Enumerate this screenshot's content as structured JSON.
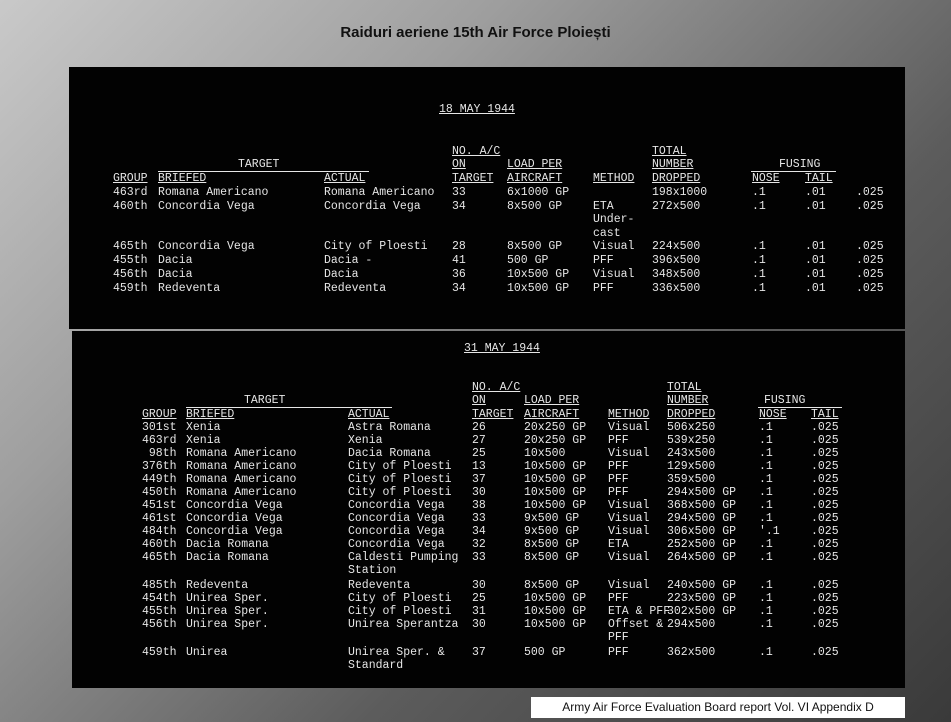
{
  "title": "Raiduri aeriene 15th Air Force Ploiești",
  "source": "Army Air Force  Evaluation Board report Vol. VI Appendix D",
  "tables": [
    {
      "date": "18 MAY 1944",
      "headers": {
        "group": "GROUP",
        "target": "TARGET",
        "briefed": "BRIEFED",
        "actual": "ACTUAL",
        "ac": [
          "NO. A/C",
          "ON",
          "TARGET"
        ],
        "load": [
          "LOAD PER",
          "AIRCRAFT"
        ],
        "method": "METHOD",
        "total": [
          "TOTAL",
          "NUMBER",
          "DROPPED"
        ],
        "fusing": "FUSING",
        "nose": "NOSE",
        "tail": "TAIL"
      },
      "rows": [
        {
          "group": "463rd",
          "briefed": "Romana Americano",
          "actual": "Romana Americano",
          "ac": "33",
          "load": "6x1000 GP",
          "method": "",
          "total": "198x1000",
          "nose": ".1",
          "tail": ".01",
          "extra": ".025"
        },
        {
          "group": "460th",
          "briefed": "Concordia Vega",
          "actual": "Concordia Vega",
          "ac": "34",
          "load": "8x500 GP",
          "method": "ETA\nUnder-\ncast",
          "total": "272x500",
          "nose": ".1",
          "tail": ".01",
          "extra": ".025"
        },
        {
          "group": "465th",
          "briefed": "Concordia Vega",
          "actual": "City of Ploesti",
          "ac": "28",
          "load": "8x500 GP",
          "method": "Visual",
          "total": "224x500",
          "nose": ".1",
          "tail": ".01",
          "extra": ".025"
        },
        {
          "group": "455th",
          "briefed": "Dacia",
          "actual": "Dacia -",
          "ac": "41",
          "load": "500 GP",
          "method": "PFF",
          "total": "396x500",
          "nose": ".1",
          "tail": ".01",
          "extra": ".025"
        },
        {
          "group": "456th",
          "briefed": "Dacia",
          "actual": "Dacia",
          "ac": "36",
          "load": "10x500 GP",
          "method": "Visual",
          "total": "348x500",
          "nose": ".1",
          "tail": ".01",
          "extra": ".025"
        },
        {
          "group": "459th",
          "briefed": "Redeventa",
          "actual": "Redeventa",
          "ac": "34",
          "load": "10x500 GP",
          "method": "PFF",
          "total": "336x500",
          "nose": ".1",
          "tail": ".01",
          "extra": ".025"
        }
      ]
    },
    {
      "date": "31 MAY 1944",
      "headers": {
        "group": "GROUP",
        "target": "TARGET",
        "briefed": "BRIEFED",
        "actual": "ACTUAL",
        "ac": [
          "NO. A/C",
          "ON",
          "TARGET"
        ],
        "load": [
          "LOAD PER",
          "AIRCRAFT"
        ],
        "method": "METHOD",
        "total": [
          "TOTAL",
          "NUMBER",
          "DROPPED"
        ],
        "fusing": "FUSING",
        "nose": "NOSE",
        "tail": "TAIL"
      },
      "rows": [
        {
          "group": "301st",
          "briefed": "Xenia",
          "actual": "Astra Romana",
          "ac": "26",
          "load": "20x250 GP",
          "method": "Visual",
          "total": "506x250",
          "nose": ".1",
          "tail": ".025"
        },
        {
          "group": "463rd",
          "briefed": "Xenia",
          "actual": "Xenia",
          "ac": "27",
          "load": "20x250 GP",
          "method": "PFF",
          "total": "539x250",
          "nose": ".1",
          "tail": ".025"
        },
        {
          "group": "98th",
          "briefed": "Romana Americano",
          "actual": "Dacia Romana",
          "ac": "25",
          "load": "10x500",
          "method": "Visual",
          "total": "243x500",
          "nose": ".1",
          "tail": ".025"
        },
        {
          "group": "376th",
          "briefed": "Romana Americano",
          "actual": "City of Ploesti",
          "ac": "13",
          "load": "10x500 GP",
          "method": "PFF",
          "total": "129x500",
          "nose": ".1",
          "tail": ".025"
        },
        {
          "group": "449th",
          "briefed": "Romana Americano",
          "actual": "City of Ploesti",
          "ac": "37",
          "load": "10x500 GP",
          "method": "PFF",
          "total": "359x500",
          "nose": ".1",
          "tail": ".025"
        },
        {
          "group": "450th",
          "briefed": "Romana Americano",
          "actual": "City of Ploesti",
          "ac": "30",
          "load": "10x500 GP",
          "method": "PFF",
          "total": "294x500 GP",
          "nose": ".1",
          "tail": ".025"
        },
        {
          "group": "451st",
          "briefed": "Concordia Vega",
          "actual": "Concordia Vega",
          "ac": "38",
          "load": "10x500 GP",
          "method": "Visual",
          "total": "368x500 GP",
          "nose": ".1",
          "tail": ".025"
        },
        {
          "group": "461st",
          "briefed": "Concordia Vega",
          "actual": "Concordia Vega",
          "ac": "33",
          "load": "9x500 GP",
          "method": "Visual",
          "total": "294x500 GP",
          "nose": ".1",
          "tail": ".025"
        },
        {
          "group": "484th",
          "briefed": "Concordia Vega",
          "actual": "Concordia Vega",
          "ac": "34",
          "load": "9x500 GP",
          "method": "Visual",
          "total": "306x500 GP",
          "nose": "'.1",
          "tail": ".025"
        },
        {
          "group": "460th",
          "briefed": "Dacia Romana",
          "actual": "Concordia Vega",
          "ac": "32",
          "load": "8x500 GP",
          "method": "ETA",
          "total": "252x500 GP",
          "nose": ".1",
          "tail": ".025"
        },
        {
          "group": "465th",
          "briefed": "Dacia Romana",
          "actual": "Caldesti Pumping\nStation",
          "ac": "33",
          "load": "8x500 GP",
          "method": "Visual",
          "total": "264x500 GP",
          "nose": ".1",
          "tail": ".025"
        },
        {
          "group": "485th",
          "briefed": "Redeventa",
          "actual": "Redeventa",
          "ac": "30",
          "load": "8x500 GP",
          "method": "Visual",
          "total": "240x500 GP",
          "nose": ".1",
          "tail": ".025"
        },
        {
          "group": "454th",
          "briefed": "Unirea Sper.",
          "actual": "City of Ploesti",
          "ac": "25",
          "load": "10x500 GP",
          "method": "PFF",
          "total": "223x500 GP",
          "nose": ".1",
          "tail": ".025"
        },
        {
          "group": "455th",
          "briefed": "Unirea Sper.",
          "actual": "City of Ploesti",
          "ac": "31",
          "load": "10x500 GP",
          "method": "ETA & PFF",
          "total": "302x500 GP",
          "nose": ".1",
          "tail": ".025"
        },
        {
          "group": "456th",
          "briefed": "Unirea Sper.",
          "actual": "Unirea Sperantza",
          "ac": "30",
          "load": "10x500 GP",
          "method": "Offset &\nPFF",
          "total": "294x500",
          "nose": ".1",
          "tail": ".025"
        },
        {
          "group": "459th",
          "briefed": "Unirea",
          "actual": "Unirea Sper. &\nStandard",
          "ac": "37",
          "load": "500 GP",
          "method": "PFF",
          "total": "362x500",
          "nose": ".1",
          "tail": ".025"
        }
      ]
    }
  ]
}
